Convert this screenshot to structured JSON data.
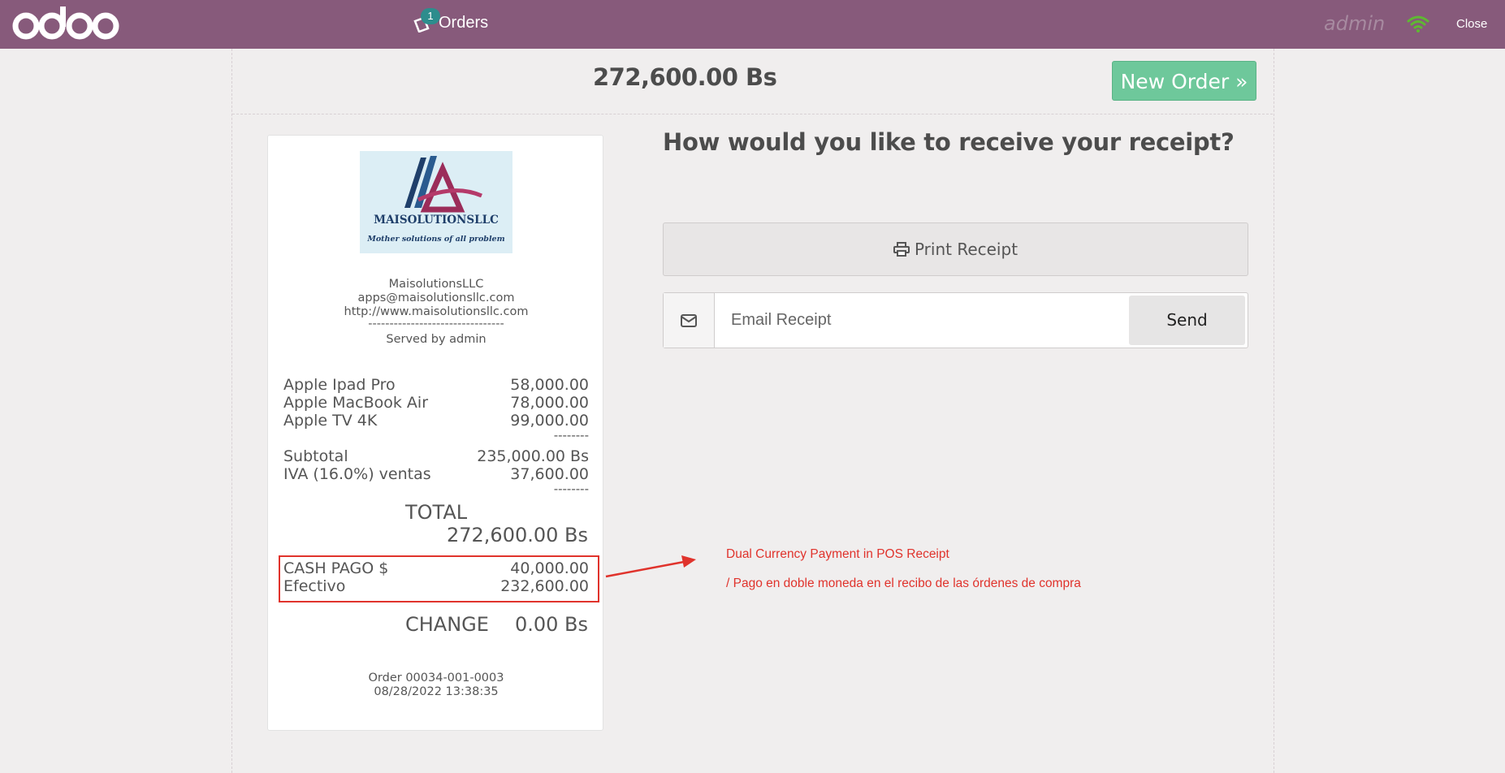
{
  "topbar": {
    "logo_text": "odoo",
    "orders_label": "Orders",
    "orders_count": "1",
    "user": "admin",
    "close_label": "Close"
  },
  "header": {
    "total": "272,600.00 Bs",
    "new_order_label": "New Order »"
  },
  "receipt": {
    "logo_company": "MAISOLUTIONSLLC",
    "logo_tagline": "Mother solutions of all problem",
    "company_name": "MaisolutionsLLC",
    "email": "apps@maisolutionsllc.com",
    "website": "http://www.maisolutionsllc.com",
    "separator": "--------------------------------",
    "served_by": "Served by admin",
    "lines": [
      {
        "name": "Apple Ipad Pro",
        "amount": "58,000.00"
      },
      {
        "name": "Apple MacBook Air",
        "amount": "78,000.00"
      },
      {
        "name": "Apple TV 4K",
        "amount": "99,000.00"
      }
    ],
    "short_separator": "--------",
    "subtotal_label": "Subtotal",
    "subtotal_value": "235,000.00 Bs",
    "tax_label": "IVA (16.0%) ventas",
    "tax_value": "37,600.00",
    "total_label": "TOTAL",
    "total_value": "272,600.00 Bs",
    "payments": [
      {
        "name": "CASH PAGO $",
        "amount": "40,000.00"
      },
      {
        "name": "Efectivo",
        "amount": "232,600.00"
      }
    ],
    "change_label": "CHANGE",
    "change_value": "0.00 Bs",
    "order_ref": "Order 00034-001-0003",
    "order_date": "08/28/2022 13:38:35"
  },
  "main": {
    "question": "How would you like to receive your receipt?",
    "print_label": "Print Receipt",
    "email_placeholder": "Email Receipt",
    "send_label": "Send"
  },
  "annotation": {
    "line1": "Dual Currency Payment in POS Receipt",
    "line2": "/ Pago en doble moneda en el recibo de las órdenes de compra",
    "color": "#e0332c"
  },
  "colors": {
    "topbar": "#875a7b",
    "new_order": "#6ec89b",
    "badge": "#2d8d8d",
    "wifi": "#5fb832"
  }
}
